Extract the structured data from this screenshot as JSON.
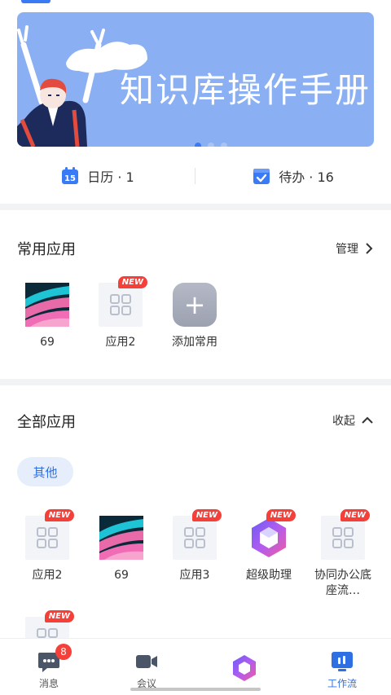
{
  "banner": {
    "title": "知识库操作手册",
    "dots": 3,
    "active_dot": 0
  },
  "quick": {
    "calendar_label": "日历 · 1",
    "todo_label": "待办 · 16"
  },
  "frequent": {
    "title": "常用应用",
    "action": "管理",
    "apps": [
      {
        "label": "69",
        "icon": "wallpaper-app-icon",
        "badge": ""
      },
      {
        "label": "应用2",
        "icon": "grid-app-icon",
        "badge": "NEW"
      },
      {
        "label": "添加常用",
        "icon": "plus-icon",
        "badge": ""
      }
    ]
  },
  "all_apps": {
    "title": "全部应用",
    "action": "收起",
    "category": "其他",
    "apps": [
      {
        "label": "应用2",
        "icon": "grid-app-icon",
        "badge": "NEW"
      },
      {
        "label": "69",
        "icon": "wallpaper-app-icon",
        "badge": ""
      },
      {
        "label": "应用3",
        "icon": "grid-app-icon",
        "badge": "NEW"
      },
      {
        "label": "超级助理",
        "icon": "hexagon-assistant-icon",
        "badge": "NEW"
      },
      {
        "label": "协同办公底座流…",
        "icon": "grid-app-icon",
        "badge": "NEW"
      },
      {
        "label": "",
        "icon": "grid-app-icon",
        "badge": "NEW"
      }
    ]
  },
  "tabbar": {
    "tabs": [
      {
        "label": "消息",
        "icon": "message-icon",
        "badge": "8"
      },
      {
        "label": "会议",
        "icon": "video-meeting-icon",
        "badge": ""
      },
      {
        "label": "",
        "icon": "hexagon-assistant-icon",
        "badge": ""
      },
      {
        "label": "工作流",
        "icon": "workflow-icon",
        "badge": ""
      }
    ],
    "active_index": 3
  },
  "colors": {
    "accent": "#2f6fe4",
    "banner_bg": "#8ab0f3",
    "badge_red": "#f5403a"
  }
}
